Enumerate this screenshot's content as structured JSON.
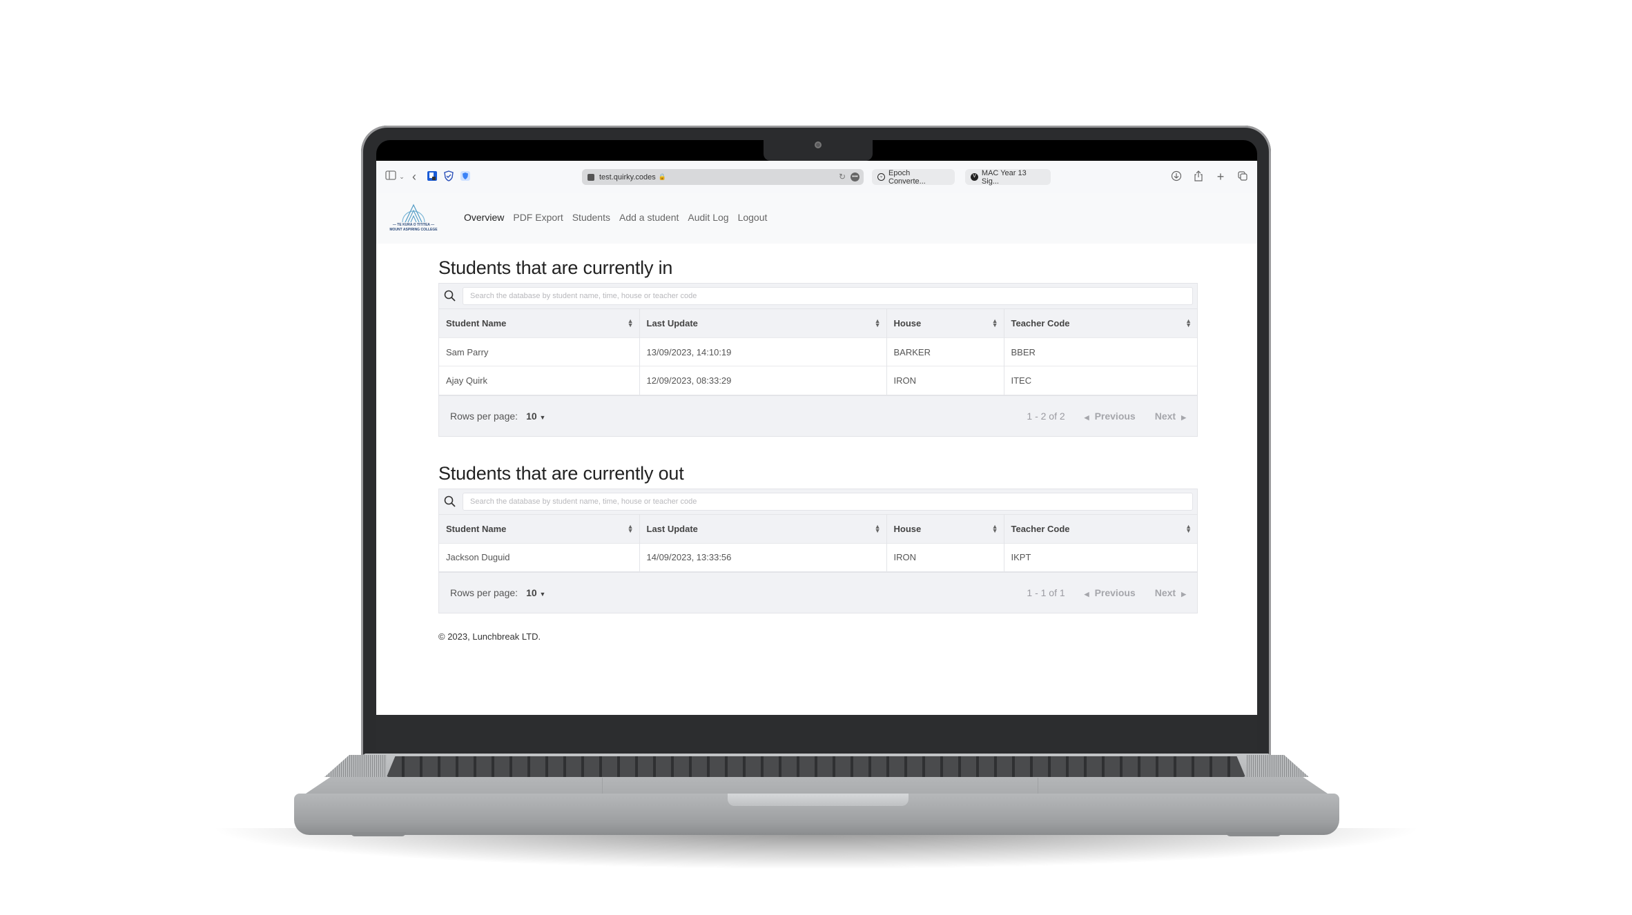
{
  "browser": {
    "url": "test.quirky.codes",
    "tabs": [
      {
        "label": "Epoch Converte..."
      },
      {
        "label": "MAC Year 13 Sig..."
      }
    ]
  },
  "site": {
    "logo": {
      "line1": "— TE KURA O TITITEA —",
      "line2": "MOUNT ASPIRING COLLEGE"
    },
    "nav": [
      {
        "label": "Overview",
        "active": true
      },
      {
        "label": "PDF Export"
      },
      {
        "label": "Students"
      },
      {
        "label": "Add a student"
      },
      {
        "label": "Audit Log"
      },
      {
        "label": "Logout"
      }
    ]
  },
  "tables": [
    {
      "title": "Students that are currently in",
      "search_placeholder": "Search the database by student name, time, house or teacher code",
      "columns": [
        "Student Name",
        "Last Update",
        "House",
        "Teacher Code"
      ],
      "rows": [
        [
          "Sam Parry",
          "13/09/2023, 14:10:19",
          "BARKER",
          "BBER"
        ],
        [
          "Ajay Quirk",
          "12/09/2023, 08:33:29",
          "IRON",
          "ITEC"
        ]
      ],
      "rows_per_page_label": "Rows per page:",
      "rows_per_page": "10",
      "range": "1 - 2 of 2",
      "prev_label": "Previous",
      "next_label": "Next"
    },
    {
      "title": "Students that are currently out",
      "search_placeholder": "Search the database by student name, time, house or teacher code",
      "columns": [
        "Student Name",
        "Last Update",
        "House",
        "Teacher Code"
      ],
      "rows": [
        [
          "Jackson Duguid",
          "14/09/2023, 13:33:56",
          "IRON",
          "IKPT"
        ]
      ],
      "rows_per_page_label": "Rows per page:",
      "rows_per_page": "10",
      "range": "1 - 1 of 1",
      "prev_label": "Previous",
      "next_label": "Next"
    }
  ],
  "footer": "© 2023, Lunchbreak LTD.",
  "icons": {
    "sidebar": "sidebar-toggle-icon",
    "back": "back-arrow-icon",
    "bitwarden": "password-manager-icon",
    "shield": "shield-check-icon",
    "search": "search-icon",
    "sort": "sort-icon"
  }
}
